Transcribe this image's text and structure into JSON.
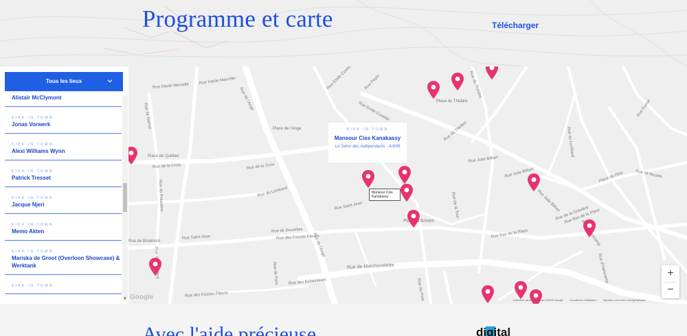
{
  "header": {
    "title": "Programme et carte",
    "download_label": "Télécharger"
  },
  "filter": {
    "selected": "Tous les lieux"
  },
  "venues": [
    {
      "tag": "",
      "name": "Alistair McClymont"
    },
    {
      "tag": "KIKK IN TOWN",
      "name": "Jonas Vorwerk"
    },
    {
      "tag": "KIKK IN TOWN",
      "name": "Alexi Williams Wynn"
    },
    {
      "tag": "KIKK IN TOWN",
      "name": "Patrick Tresset"
    },
    {
      "tag": "KIKK IN TOWN",
      "name": "Jacque Njeri"
    },
    {
      "tag": "KIKK IN TOWN",
      "name": "Memo Akten"
    },
    {
      "tag": "KIKK IN TOWN",
      "name": "Mariska de Groot (Overloon Showcase) & Werktank"
    },
    {
      "tag": "KIKK IN TOWN",
      "name": ""
    }
  ],
  "map": {
    "info_card": {
      "tag": "KIKK IN TOWN",
      "name": "Mansour Ciss Kanakassy",
      "venue": "Le Salon des indépendants - Arthfill"
    },
    "tooltip": "Mansour Ciss Kanakassy",
    "zoom_in": "+",
    "zoom_out": "−",
    "google": "Google",
    "footer_items": [
      "Données cartographiques ©2018 Google",
      "Conditions d'utilisation",
      "Signaler une erreur cartographique"
    ],
    "streets": [
      {
        "name": "Rue Haute Marcelle"
      },
      {
        "name": "Rue Haute Marcelle"
      },
      {
        "name": "Rue de l'Ange"
      },
      {
        "name": "Rue Emile Cuvelier"
      },
      {
        "name": "Rue Emile Cuvelier"
      },
      {
        "name": "Rue Pepin"
      },
      {
        "name": "Place du Théâtre"
      },
      {
        "name": "Rue du Théâtre"
      },
      {
        "name": "Rue du Théâtre"
      },
      {
        "name": "Rue de Namur"
      },
      {
        "name": "Place de l'Ange"
      },
      {
        "name": "Place de Québec"
      },
      {
        "name": "Rue de la Croix"
      },
      {
        "name": "Rue de la Croix"
      },
      {
        "name": "Rue du Président"
      },
      {
        "name": "Rue du Président"
      },
      {
        "name": "Rue du Lombard"
      },
      {
        "name": "Rue Saint-Jean"
      },
      {
        "name": "Rue des Fossés Fleuris"
      },
      {
        "name": "Rue de l'Ange"
      },
      {
        "name": "Rue de Marchovelette"
      },
      {
        "name": "Rue des Echasseurs"
      },
      {
        "name": "Rue des Fossés Fleuris"
      },
      {
        "name": "Rue Julie Billiart"
      },
      {
        "name": "Rue Julie Billiart"
      },
      {
        "name": "Rue Julie Billiart"
      },
      {
        "name": "Rue de la Tour"
      },
      {
        "name": "Place de l'Ilon"
      },
      {
        "name": "Rue St Nicolas"
      },
      {
        "name": "Rue du Lombard"
      },
      {
        "name": "Rue de la Gravière"
      },
      {
        "name": "Rue Bas de la Place"
      },
      {
        "name": "Rue Bas de la Place"
      },
      {
        "name": "Rue d'Harscamp"
      },
      {
        "name": "Rue Fumal"
      },
      {
        "name": "Rue du Pont"
      },
      {
        "name": "Place d'Armes"
      },
      {
        "name": "Rue de Bruxelles"
      },
      {
        "name": "Rue du Pont"
      },
      {
        "name": "Rue Saint-Jean"
      },
      {
        "name": "Rue d'Harscamp"
      },
      {
        "name": "Rue de Brialmont"
      }
    ]
  },
  "footer": {
    "title": "Avec l'aide précieuse",
    "partner": "digital"
  },
  "colors": {
    "brand_blue": "#1f4fe0",
    "pin_pink": "#e8336f",
    "dropdown_bg": "#1f5fe3"
  }
}
